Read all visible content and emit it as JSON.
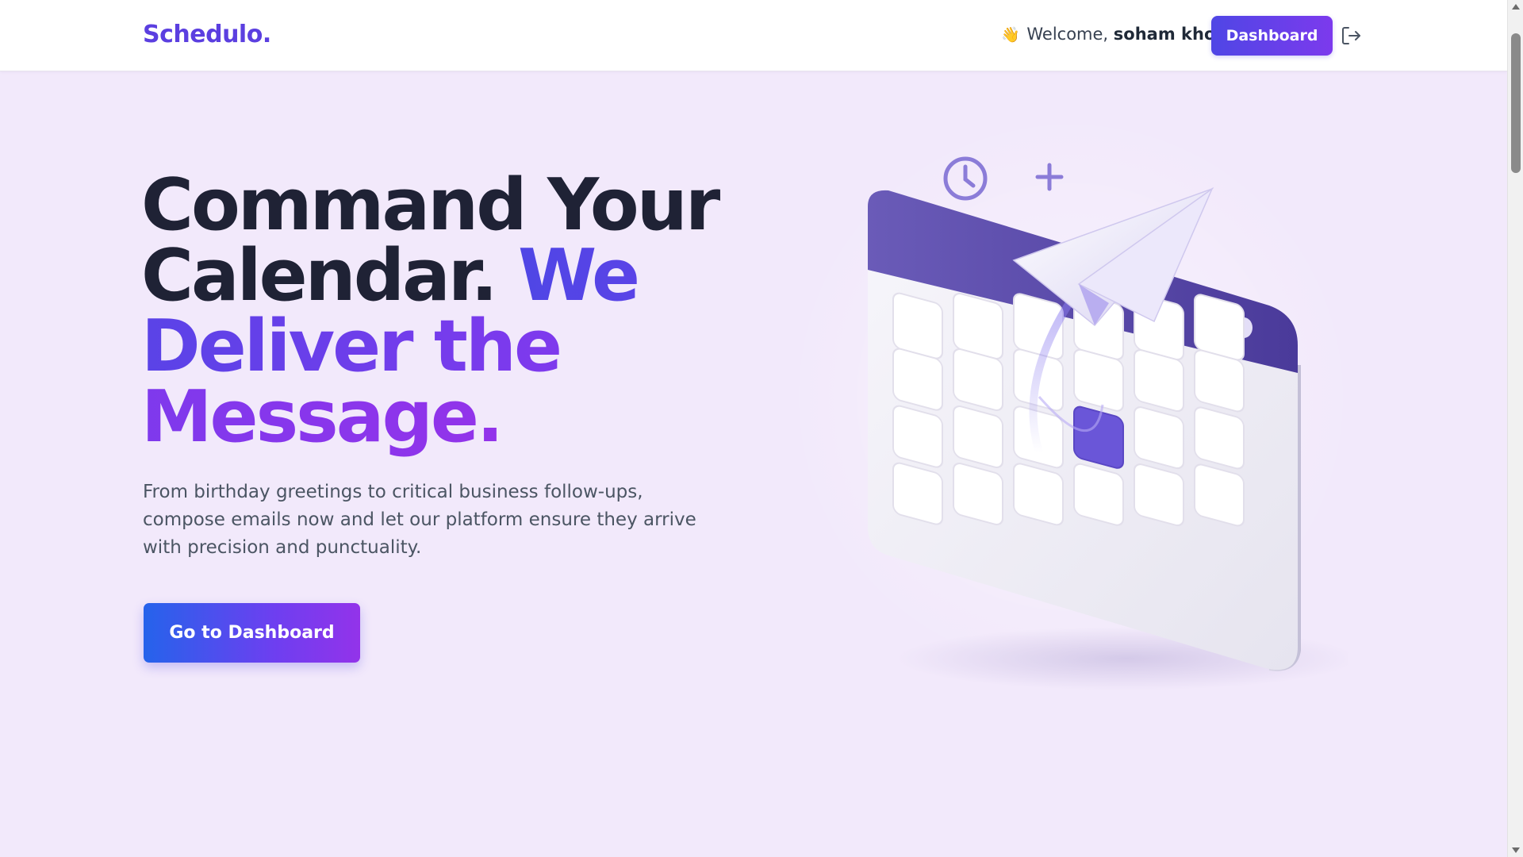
{
  "header": {
    "logo": "Schedulo.",
    "welcome_emoji": "👋",
    "welcome_text": "Welcome,",
    "user_name": "soham khot",
    "dashboard_button": "Dashboard"
  },
  "hero": {
    "headline_dark": "Command Your Calendar. ",
    "headline_accent": "We Deliver the Message.",
    "description": "From birthday greetings to critical business follow-ups, compose emails now and let our platform ensure they arrive with precision and punctuality.",
    "cta_label": "Go to Dashboard"
  },
  "colors": {
    "brand": "#5b3fe0",
    "gradient_start": "#4f46e5",
    "gradient_end": "#9333ea",
    "page_background": "#f2e9fb"
  },
  "icons": {
    "logout": "logout-icon",
    "clock": "clock-icon",
    "plus": "plus-icon",
    "paper_plane": "paper-plane-icon"
  }
}
